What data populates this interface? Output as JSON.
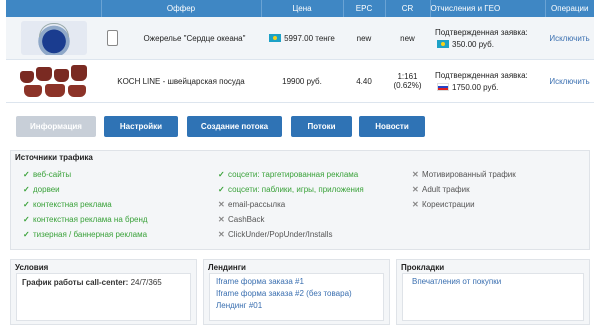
{
  "table": {
    "headers": [
      "Оффер",
      "Цена",
      "EPC",
      "CR",
      "Отчисления и ГЕО",
      "Операции"
    ],
    "rows": [
      {
        "offer": "Ожерелье \"Сердце океана\"",
        "price": "5997.00 тенге",
        "epc": "new",
        "cr": "new",
        "geo_label": "Подтвержденная заявка:",
        "geo_value": "350.00 руб.",
        "geo_flag": "kz-flag",
        "action": "Исключить"
      },
      {
        "offer": "KOCH LINE - швейцарская посуда",
        "price": "19900 руб.",
        "epc": "4.40",
        "cr": "1:161",
        "cr_pct": "(0.62%)",
        "geo_label": "Подтвержденная заявка:",
        "geo_value": "1750.00 руб.",
        "geo_flag": "ru-flag",
        "action": "Исключить"
      }
    ]
  },
  "tabs": [
    "Информация",
    "Настройки",
    "Создание потока",
    "Потоки",
    "Новости"
  ],
  "sources": {
    "title": "Источники трафика",
    "col1": [
      {
        "label": "веб-сайты",
        "ok": true
      },
      {
        "label": "дорвеи",
        "ok": true
      },
      {
        "label": "контекстная реклама",
        "ok": true
      },
      {
        "label": "контекстная реклама на бренд",
        "ok": true
      },
      {
        "label": "тизерная / баннерная реклама",
        "ok": true
      }
    ],
    "col2": [
      {
        "label": "соцсети: таргетированная реклама",
        "ok": true
      },
      {
        "label": "соцсети: паблики, игры, приложения",
        "ok": true
      },
      {
        "label": "email-рассылка",
        "ok": false
      },
      {
        "label": "CashBack",
        "ok": false
      },
      {
        "label": "ClickUnder/PopUnder/Installs",
        "ok": false
      }
    ],
    "col3": [
      {
        "label": "Мотивированный трафик",
        "ok": false
      },
      {
        "label": "Adult трафик",
        "ok": false
      },
      {
        "label": "Кореистрации",
        "ok": false
      }
    ]
  },
  "conditions": {
    "title": "Условия",
    "callcenter_label": "График работы call-center:",
    "callcenter_value": "24/7/365"
  },
  "landings": {
    "title": "Лендинги",
    "items": [
      "Iframe форма заказа #1",
      "Iframe форма заказа #2 (без товара)",
      "Лендинг #01"
    ]
  },
  "prelandings": {
    "title": "Прокладки",
    "items": [
      "Впечатления от покупки"
    ]
  },
  "colors": {
    "header": "#3f87c4",
    "button": "#2f73b5",
    "ok": "#3aa23a",
    "link": "#3a6fb0"
  }
}
